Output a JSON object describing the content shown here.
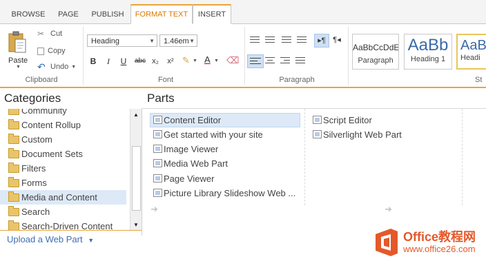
{
  "tabs": [
    "BROWSE",
    "PAGE",
    "PUBLISH",
    "FORMAT TEXT",
    "INSERT"
  ],
  "active_tab": "FORMAT TEXT",
  "clipboard": {
    "paste": "Paste",
    "cut": "Cut",
    "copy": "Copy",
    "undo": "Undo",
    "label": "Clipboard"
  },
  "font": {
    "style_value": "Heading",
    "size_value": "1.46em",
    "label": "Font",
    "buttons": [
      "B",
      "I",
      "U",
      "abc",
      "x₂",
      "x²"
    ]
  },
  "paragraph": {
    "label": "Paragraph"
  },
  "styles": {
    "label": "St",
    "items": [
      {
        "preview": "AaBbCcDdE",
        "name": "Paragraph"
      },
      {
        "preview": "AaBb",
        "name": "Heading 1"
      },
      {
        "preview": "AaBb",
        "name": "Headi"
      }
    ]
  },
  "categories": {
    "header": "Categories",
    "items": [
      "Community",
      "Content Rollup",
      "Custom",
      "Document Sets",
      "Filters",
      "Forms",
      "Media and Content",
      "Search",
      "Search-Driven Content"
    ],
    "selected": "Media and Content"
  },
  "parts": {
    "header": "Parts",
    "column1": [
      "Content Editor",
      "Get started with your site",
      "Image Viewer",
      "Media Web Part",
      "Page Viewer",
      "Picture Library Slideshow Web ..."
    ],
    "column2": [
      "Script Editor",
      "Silverlight Web Part"
    ],
    "selected": "Content Editor"
  },
  "upload_label": "Upload a Web Part",
  "watermark": {
    "brand": "Office教程网",
    "url": "www.office26.com"
  },
  "colors": {
    "accent_orange": "#e8a33b",
    "tab_active_text": "#d77800",
    "selection": "#dde9f6",
    "link_blue": "#3f6fb0"
  }
}
